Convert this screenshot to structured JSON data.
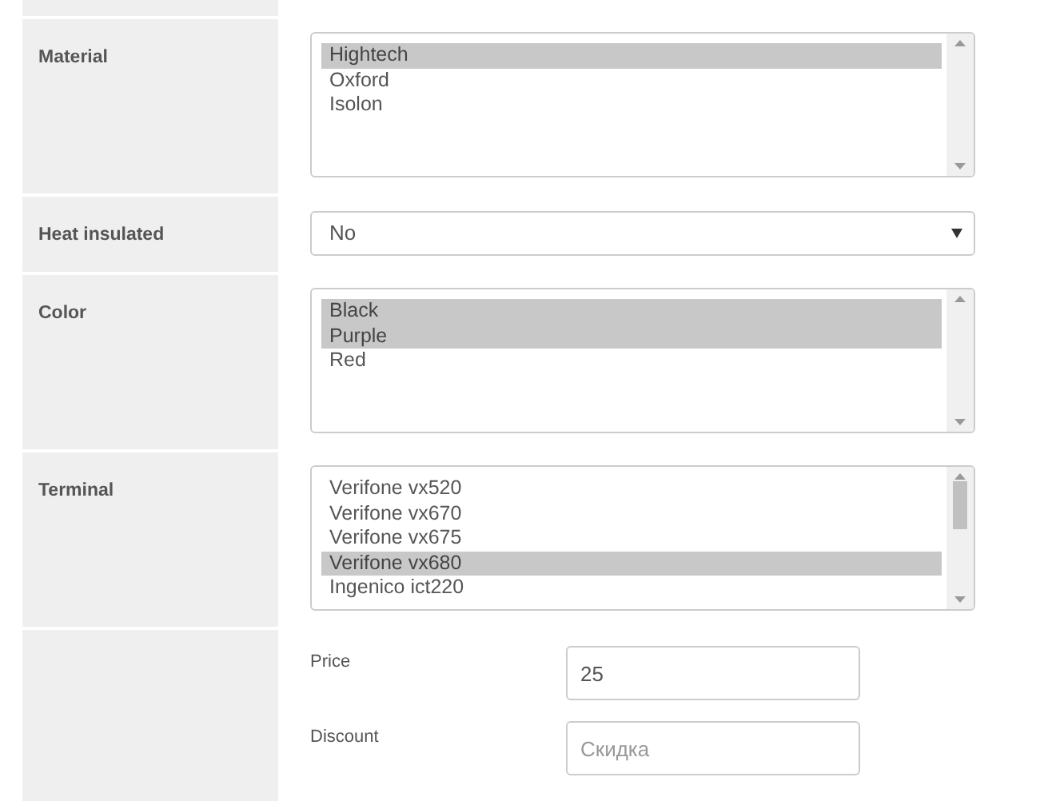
{
  "fields": [
    {
      "kind": "listbox",
      "label": "Material",
      "options": [
        {
          "text": "Hightech",
          "selected": true
        },
        {
          "text": "Oxford",
          "selected": false
        },
        {
          "text": "Isolon",
          "selected": false
        }
      ]
    },
    {
      "kind": "select",
      "label": "Heat insulated",
      "value": "No"
    },
    {
      "kind": "listbox",
      "label": "Color",
      "options": [
        {
          "text": "Black",
          "selected": true
        },
        {
          "text": "Purple",
          "selected": true
        },
        {
          "text": "Red",
          "selected": false
        }
      ]
    },
    {
      "kind": "listbox",
      "label": "Terminal",
      "scrolled": true,
      "options": [
        {
          "text": "Verifone vx520",
          "selected": false
        },
        {
          "text": "Verifone vx670",
          "selected": false
        },
        {
          "text": "Verifone vx675",
          "selected": false
        },
        {
          "text": "Verifone vx680",
          "selected": true
        },
        {
          "text": "Ingenico ict220",
          "selected": false
        }
      ]
    },
    {
      "kind": "inputs",
      "inputs": [
        {
          "label": "Price",
          "value": "25"
        },
        {
          "label": "Discount",
          "placeholder": "Скидка"
        }
      ]
    }
  ]
}
